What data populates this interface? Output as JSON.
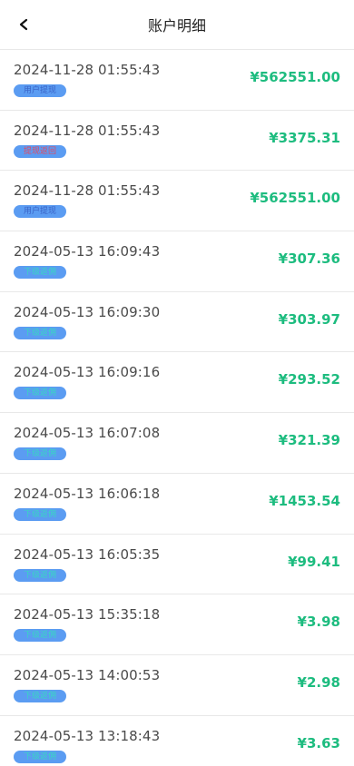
{
  "header": {
    "title": "账户明细"
  },
  "colors": {
    "amount": "#1dbc7f",
    "tag_bg": "#5b9cf2"
  },
  "records": [
    {
      "time": "2024-11-28 01:55:43",
      "tag": "用户提现",
      "amount": "¥562551.00"
    },
    {
      "time": "2024-11-28 01:55:43",
      "tag": "提现返回",
      "amount": "¥3375.31"
    },
    {
      "time": "2024-11-28 01:55:43",
      "tag": "用户提现",
      "amount": "¥562551.00"
    },
    {
      "time": "2024-05-13 16:09:43",
      "tag": "下级返佣",
      "amount": "¥307.36"
    },
    {
      "time": "2024-05-13 16:09:30",
      "tag": "下级返佣",
      "amount": "¥303.97"
    },
    {
      "time": "2024-05-13 16:09:16",
      "tag": "下级返佣",
      "amount": "¥293.52"
    },
    {
      "time": "2024-05-13 16:07:08",
      "tag": "下级返佣",
      "amount": "¥321.39"
    },
    {
      "time": "2024-05-13 16:06:18",
      "tag": "下级返佣",
      "amount": "¥1453.54"
    },
    {
      "time": "2024-05-13 16:05:35",
      "tag": "下级返佣",
      "amount": "¥99.41"
    },
    {
      "time": "2024-05-13 15:35:18",
      "tag": "下级返佣",
      "amount": "¥3.98"
    },
    {
      "time": "2024-05-13 14:00:53",
      "tag": "下级返佣",
      "amount": "¥2.98"
    },
    {
      "time": "2024-05-13 13:18:43",
      "tag": "下级返佣",
      "amount": "¥3.63"
    }
  ]
}
